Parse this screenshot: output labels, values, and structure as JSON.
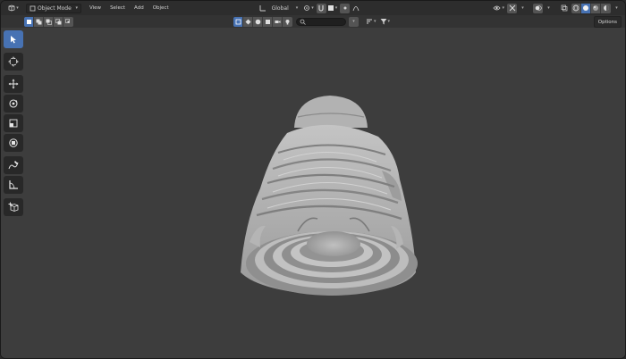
{
  "header": {
    "editor_type_icon": "3d-viewport-icon",
    "mode": "Object Mode",
    "menus": [
      "View",
      "Select",
      "Add",
      "Object"
    ],
    "transform_orientation": "Global",
    "pivot_icon": "pivot-icon",
    "snap_icon": "magnet-icon",
    "proportional_icon": "proportional-edit-icon",
    "shading_modes": [
      "wireframe",
      "solid",
      "material",
      "rendered"
    ],
    "active_shading": "solid"
  },
  "toolrow": {
    "select_modes": [
      "set",
      "extend",
      "subtract",
      "invert",
      "intersect"
    ],
    "search_placeholder": "",
    "options_label": "Options"
  },
  "toolbar": {
    "tools": [
      {
        "name": "select-box",
        "active": true
      },
      {
        "name": "cursor",
        "active": false
      },
      {
        "name": "move",
        "active": false
      },
      {
        "name": "rotate",
        "active": false
      },
      {
        "name": "scale",
        "active": false
      },
      {
        "name": "transform",
        "active": false
      },
      {
        "name": "annotate",
        "active": false
      },
      {
        "name": "measure",
        "active": false
      },
      {
        "name": "add-cube",
        "active": false
      }
    ]
  },
  "colors": {
    "accent": "#4772b3",
    "viewport_bg": "#3d3d3d",
    "header_bg": "#2d2d2d",
    "model": "#a9a9a9"
  }
}
